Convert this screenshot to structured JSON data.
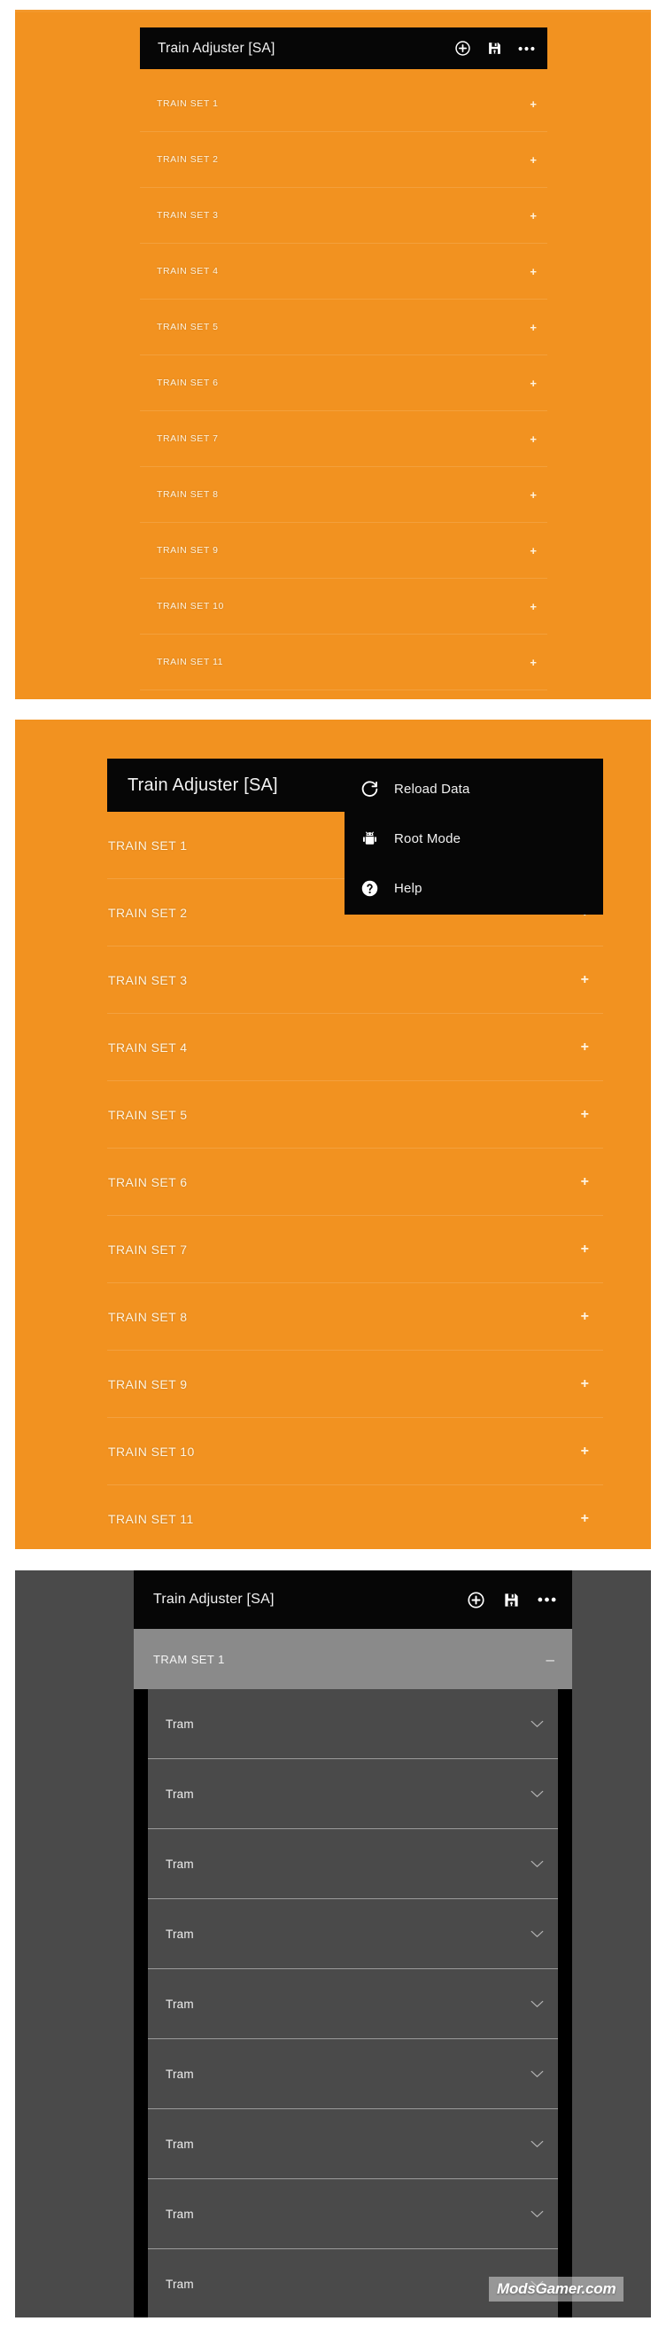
{
  "app": {
    "title": "Train Adjuster [SA]",
    "accent_orange": "#F29220",
    "appbar_black": "#060606",
    "dark_bg": "#4A4A4A",
    "highlight_gray": "#8A8A8A"
  },
  "panel1": {
    "title": "Train Adjuster [SA]",
    "actions": [
      {
        "name": "add-circle-icon",
        "label": "Add"
      },
      {
        "name": "save-icon",
        "label": "Save"
      },
      {
        "name": "overflow-menu-icon",
        "label": "More options"
      }
    ],
    "expand_symbol": "+",
    "rows": [
      "TRAIN SET 1",
      "TRAIN SET 2",
      "TRAIN SET 3",
      "TRAIN SET 4",
      "TRAIN SET 5",
      "TRAIN SET 6",
      "TRAIN SET 7",
      "TRAIN SET 8",
      "TRAIN SET 9",
      "TRAIN SET 10",
      "TRAIN SET 11"
    ]
  },
  "panel2": {
    "title": "Train Adjuster [SA]",
    "expand_symbol": "+",
    "menu": [
      {
        "label": "Reload Data",
        "icon": "reload-icon"
      },
      {
        "label": "Root Mode",
        "icon": "android-robot-icon"
      },
      {
        "label": "Help",
        "icon": "help-circle-icon"
      }
    ],
    "rows": [
      "TRAIN SET 1",
      "TRAIN SET 2",
      "TRAIN SET 3",
      "TRAIN SET 4",
      "TRAIN SET 5",
      "TRAIN SET 6",
      "TRAIN SET 7",
      "TRAIN SET 8",
      "TRAIN SET 9",
      "TRAIN SET 10",
      "TRAIN SET 11"
    ]
  },
  "panel3": {
    "title": "Train Adjuster [SA]",
    "actions": [
      {
        "name": "add-circle-icon",
        "label": "Add"
      },
      {
        "name": "save-icon",
        "label": "Save"
      },
      {
        "name": "overflow-menu-icon",
        "label": "More options"
      }
    ],
    "set_header": "TRAM SET 1",
    "collapse_symbol": "–",
    "rows": [
      "Tram",
      "Tram",
      "Tram",
      "Tram",
      "Tram",
      "Tram",
      "Tram",
      "Tram",
      "Tram"
    ]
  },
  "watermark": "ModsGamer.com"
}
